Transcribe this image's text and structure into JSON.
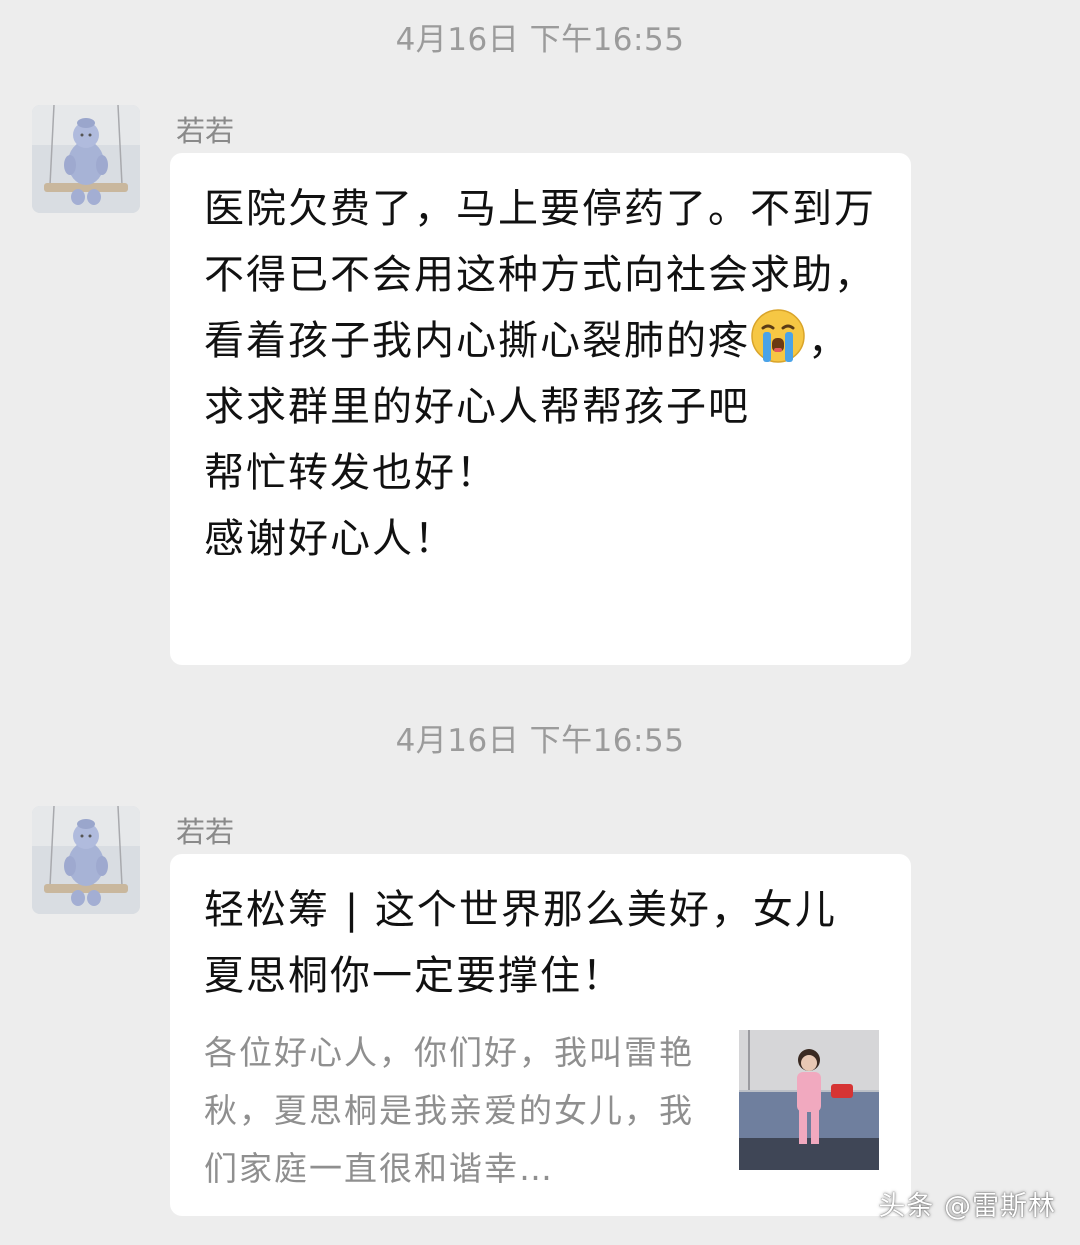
{
  "messages": [
    {
      "timestamp": "4月16日 下午16:55",
      "sender": "若若",
      "text_line1": "医院欠费了，马上要停药了。不到万不得已不会用这种方式向社会求助，看着孩子我内心撕心裂肺的疼",
      "emoji_icon": "crying-face-icon",
      "text_line2": "，求求群里的好心人帮帮孩子吧\n帮忙转发也好！\n感谢好心人！"
    },
    {
      "timestamp": "4月16日 下午16:55",
      "sender": "若若",
      "card": {
        "title": "轻松筹 | 这个世界那么美好，女儿夏思桐你一定要撑住！",
        "description": "各位好心人，你们好，我叫雷艳秋，夏思桐是我亲爱的女儿，我们家庭一直很和谐幸…"
      }
    }
  ],
  "watermark": "头条 @雷斯林",
  "colors": {
    "background": "#ededed",
    "bubble": "#ffffff",
    "timestamp": "#9b9b9b",
    "sender": "#8a8a8a"
  }
}
